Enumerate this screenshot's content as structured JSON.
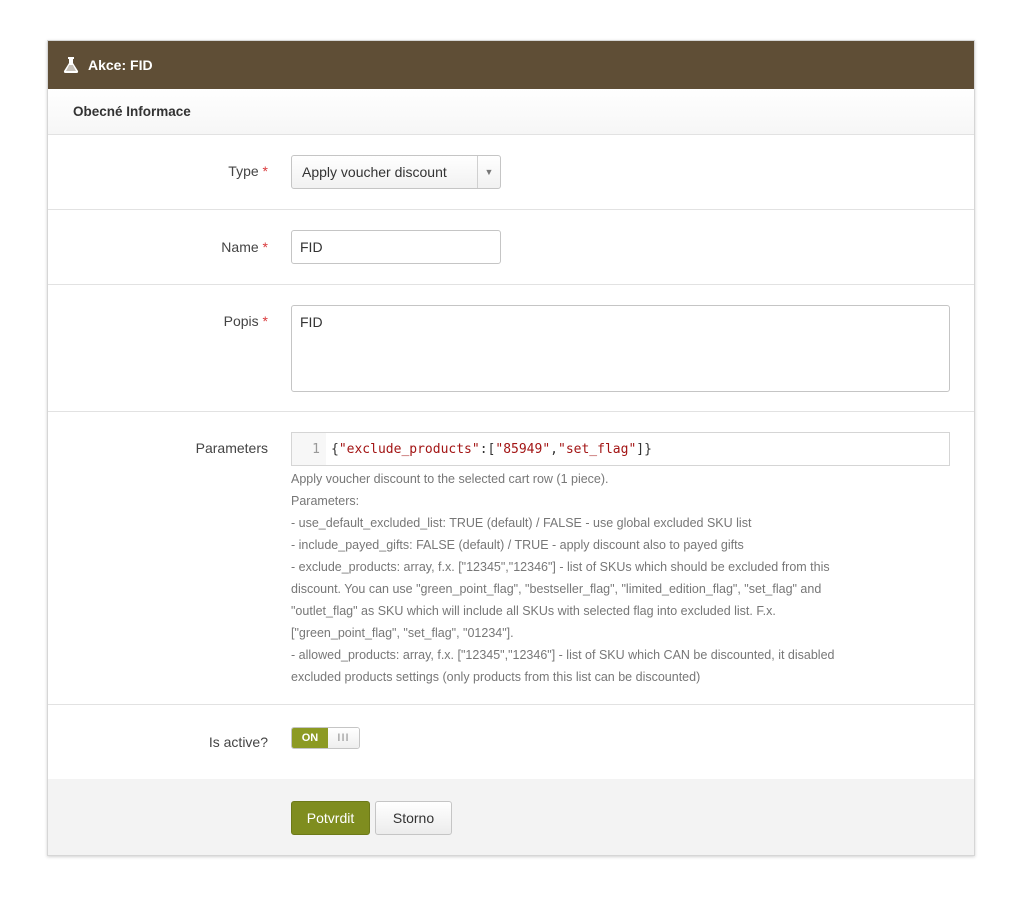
{
  "panel": {
    "title": "Akce: FID",
    "icon": "flask-icon",
    "header_color": "#5f4e36"
  },
  "section": {
    "title": "Obecné Informace"
  },
  "form": {
    "required_mark": "*",
    "type": {
      "label": "Type",
      "value": "Apply voucher discount"
    },
    "name": {
      "label": "Name",
      "value": "FID"
    },
    "popis": {
      "label": "Popis",
      "value": "FID"
    },
    "parameters": {
      "label": "Parameters",
      "line_number": "1",
      "code_parts": [
        "{",
        "\"exclude_products\"",
        ":[",
        "\"85949\"",
        ",",
        "\"set_flag\"",
        "]}"
      ],
      "help_lines": [
        "Apply voucher discount to the selected cart row (1 piece).",
        "Parameters:",
        "- use_default_excluded_list: TRUE (default) / FALSE - use global excluded SKU list",
        "- include_payed_gifts: FALSE (default) / TRUE - apply discount also to payed gifts",
        "- exclude_products: array, f.x. [\"12345\",\"12346\"] - list of SKUs which should be excluded from this",
        "discount. You can use \"green_point_flag\", \"bestseller_flag\", \"limited_edition_flag\", \"set_flag\" and",
        "\"outlet_flag\" as SKU which will include all SKUs with selected flag into excluded list. F.x.",
        "[\"green_point_flag\", \"set_flag\", \"01234\"].",
        "- allowed_products: array, f.x. [\"12345\",\"12346\"] - list of SKU which CAN be discounted, it disabled",
        "excluded products settings (only products from this list can be discounted)"
      ]
    },
    "is_active": {
      "label": "Is active?",
      "on_label": "ON",
      "off_label": "III",
      "value": true
    }
  },
  "buttons": {
    "submit": "Potvrdit",
    "cancel": "Storno"
  },
  "colors": {
    "accent": "#7f8d1f",
    "required": "#d9383a"
  }
}
